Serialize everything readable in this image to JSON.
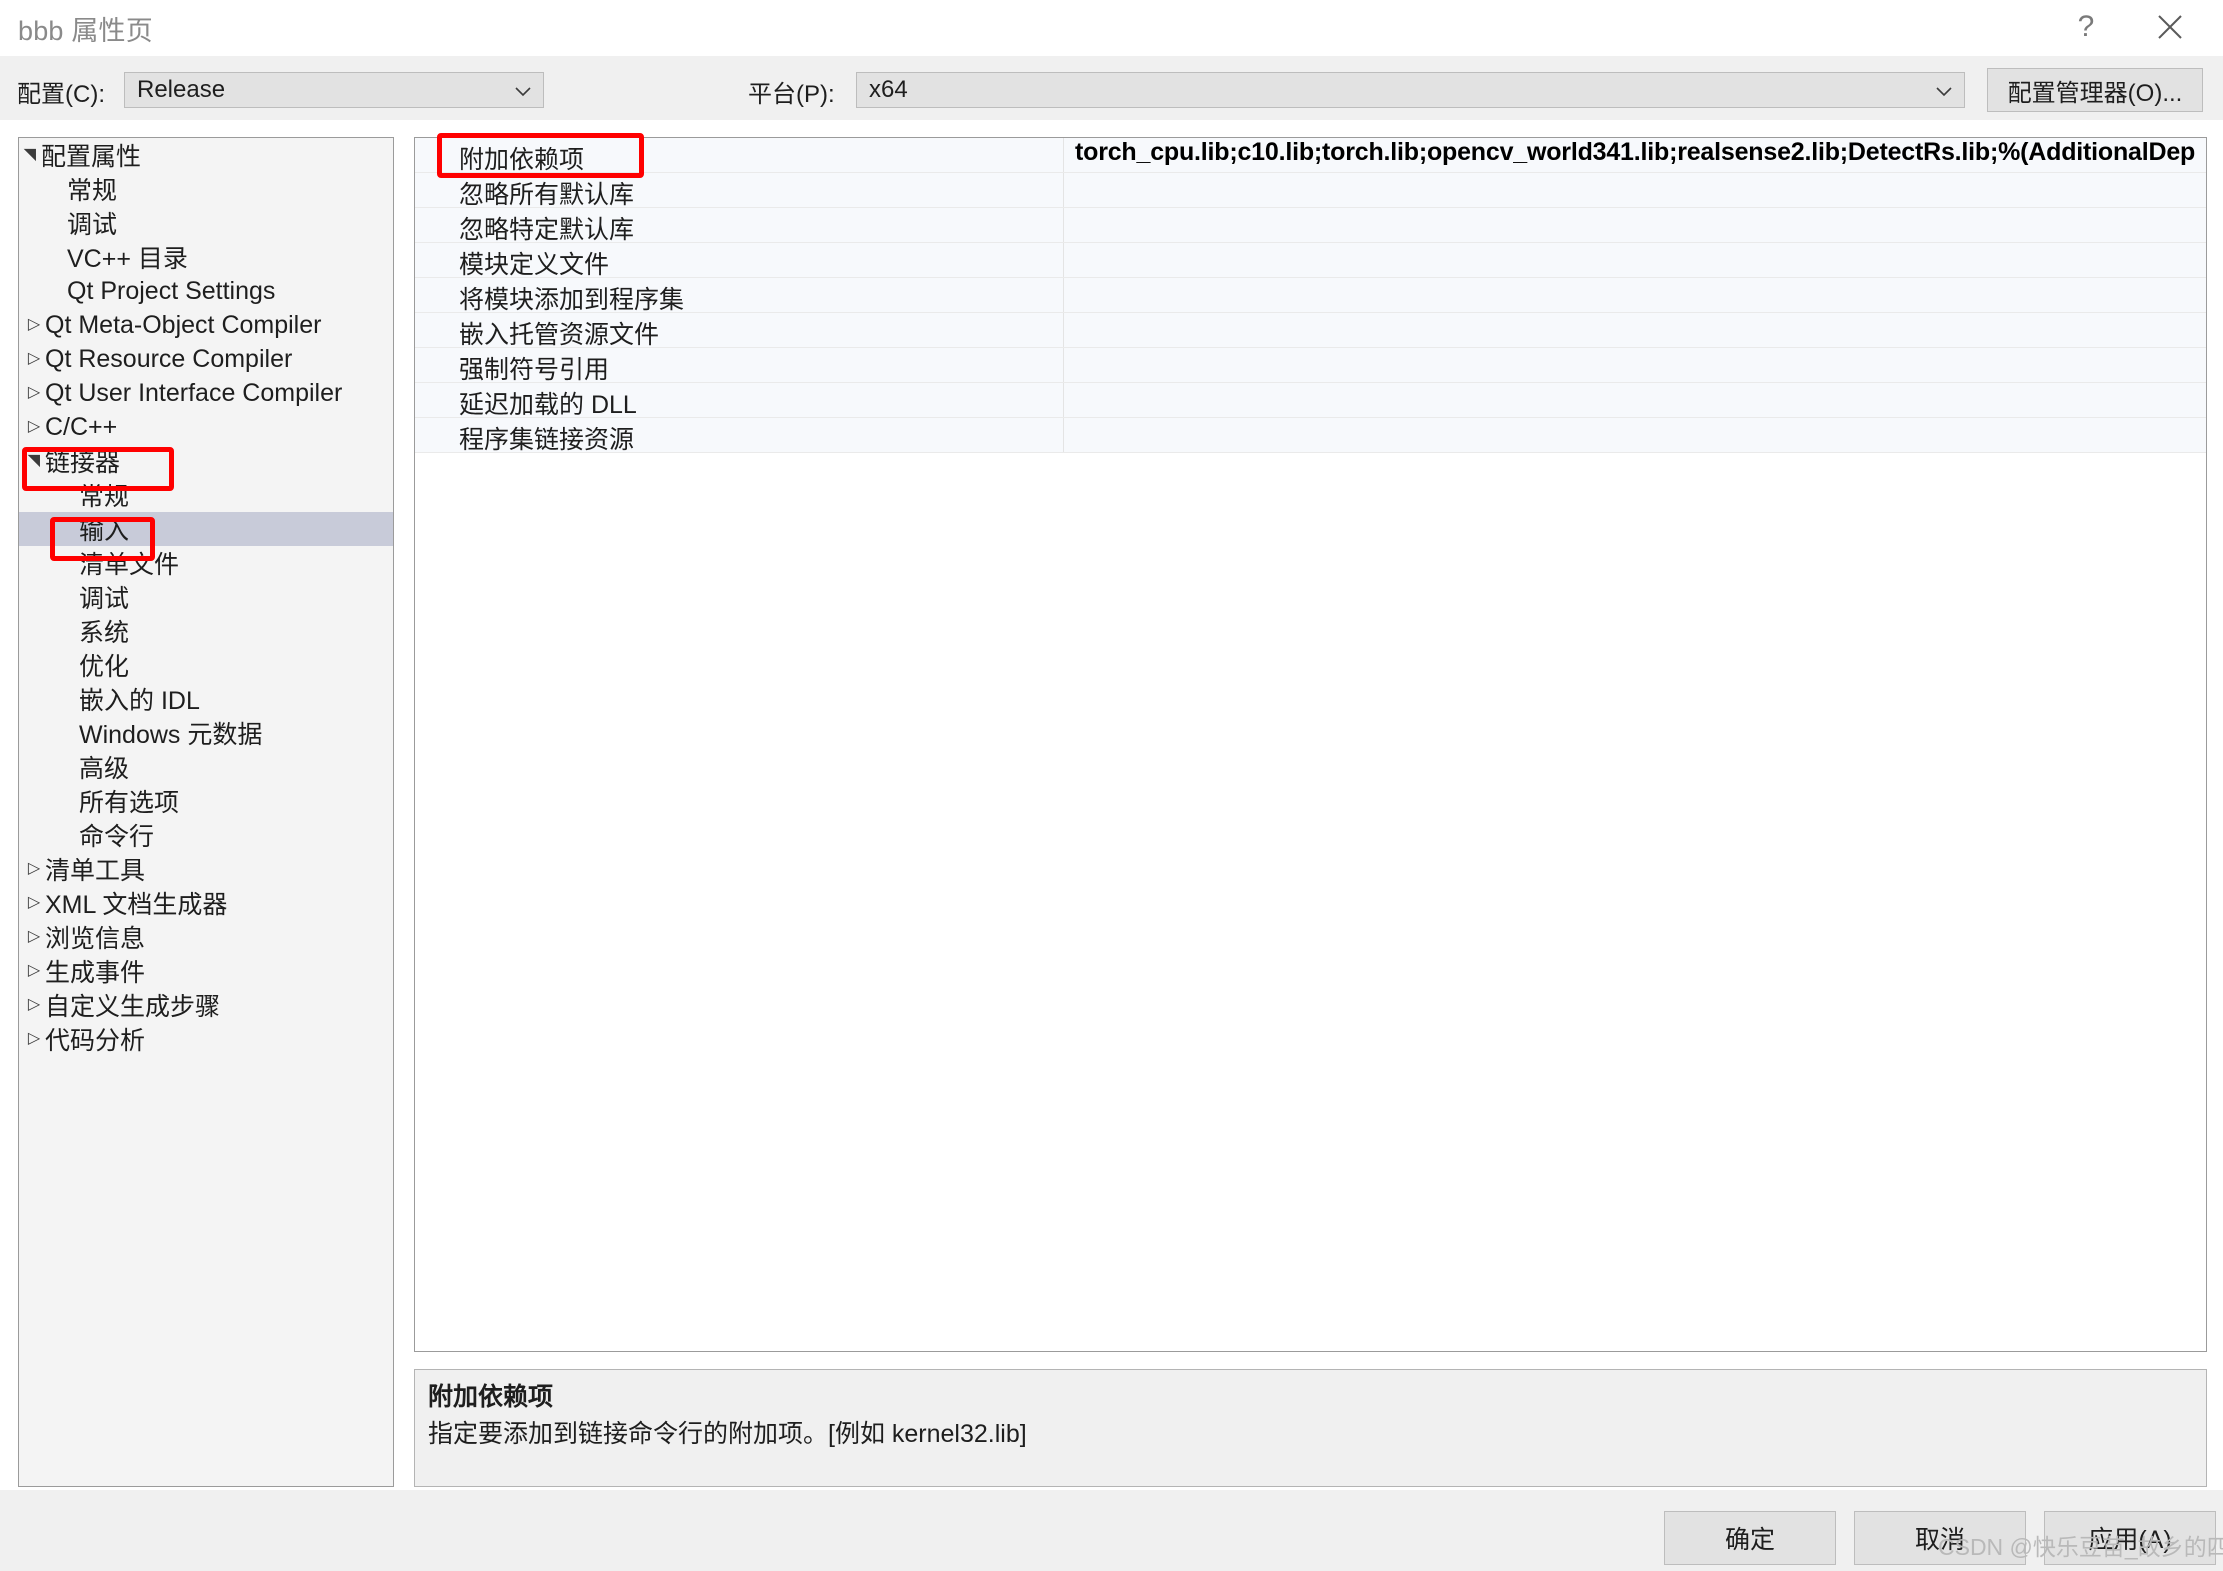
{
  "window": {
    "title": "bbb 属性页",
    "help_icon": "question-mark-icon",
    "help_glyph": "?",
    "close_icon": "close-icon"
  },
  "config_bar": {
    "configuration_label": "配置(C):",
    "configuration_value": "Release",
    "platform_label": "平台(P):",
    "platform_value": "x64",
    "config_manager_button": "配置管理器(O)...",
    "dropdown_icon": "chevron-down-icon"
  },
  "tree": {
    "items": [
      {
        "label": "配置属性",
        "indent": 14,
        "expander": "▲",
        "selected": false
      },
      {
        "label": "常规",
        "indent": 48,
        "expander": "",
        "selected": false
      },
      {
        "label": "调试",
        "indent": 48,
        "expander": "",
        "selected": false
      },
      {
        "label": "VC++ 目录",
        "indent": 48,
        "expander": "",
        "selected": false
      },
      {
        "label": "Qt Project Settings",
        "indent": 48,
        "expander": "",
        "selected": false
      },
      {
        "label": "Qt Meta-Object Compiler",
        "indent": 26,
        "expander": "▷",
        "selected": false
      },
      {
        "label": "Qt Resource Compiler",
        "indent": 26,
        "expander": "▷",
        "selected": false
      },
      {
        "label": "Qt User Interface Compiler",
        "indent": 26,
        "expander": "▷",
        "selected": false
      },
      {
        "label": "C/C++",
        "indent": 26,
        "expander": "▷",
        "selected": false
      },
      {
        "label": "链接器",
        "indent": 26,
        "expander": "▲",
        "selected": false
      },
      {
        "label": "常规",
        "indent": 60,
        "expander": "",
        "selected": false
      },
      {
        "label": "输入",
        "indent": 60,
        "expander": "",
        "selected": true
      },
      {
        "label": "清单文件",
        "indent": 60,
        "expander": "",
        "selected": false
      },
      {
        "label": "调试",
        "indent": 60,
        "expander": "",
        "selected": false
      },
      {
        "label": "系统",
        "indent": 60,
        "expander": "",
        "selected": false
      },
      {
        "label": "优化",
        "indent": 60,
        "expander": "",
        "selected": false
      },
      {
        "label": "嵌入的 IDL",
        "indent": 60,
        "expander": "",
        "selected": false
      },
      {
        "label": "Windows 元数据",
        "indent": 60,
        "expander": "",
        "selected": false
      },
      {
        "label": "高级",
        "indent": 60,
        "expander": "",
        "selected": false
      },
      {
        "label": "所有选项",
        "indent": 60,
        "expander": "",
        "selected": false
      },
      {
        "label": "命令行",
        "indent": 60,
        "expander": "",
        "selected": false
      },
      {
        "label": "清单工具",
        "indent": 26,
        "expander": "▷",
        "selected": false
      },
      {
        "label": "XML 文档生成器",
        "indent": 26,
        "expander": "▷",
        "selected": false
      },
      {
        "label": "浏览信息",
        "indent": 26,
        "expander": "▷",
        "selected": false
      },
      {
        "label": "生成事件",
        "indent": 26,
        "expander": "▷",
        "selected": false
      },
      {
        "label": "自定义生成步骤",
        "indent": 26,
        "expander": "▷",
        "selected": false
      },
      {
        "label": "代码分析",
        "indent": 26,
        "expander": "▷",
        "selected": false
      }
    ]
  },
  "properties": {
    "rows": [
      {
        "name": "附加依赖项",
        "value": "torch_cpu.lib;c10.lib;torch.lib;opencv_world341.lib;realsense2.lib;DetectRs.lib;%(AdditionalDep",
        "selected": true
      },
      {
        "name": "忽略所有默认库",
        "value": "",
        "selected": false
      },
      {
        "name": "忽略特定默认库",
        "value": "",
        "selected": false
      },
      {
        "name": "模块定义文件",
        "value": "",
        "selected": false
      },
      {
        "name": "将模块添加到程序集",
        "value": "",
        "selected": false
      },
      {
        "name": "嵌入托管资源文件",
        "value": "",
        "selected": false
      },
      {
        "name": "强制符号引用",
        "value": "",
        "selected": false
      },
      {
        "name": "延迟加载的 DLL",
        "value": "",
        "selected": false
      },
      {
        "name": "程序集链接资源",
        "value": "",
        "selected": false
      }
    ]
  },
  "description": {
    "title": "附加依赖项",
    "body": "指定要添加到链接命令行的附加项。[例如 kernel32.lib]"
  },
  "footer": {
    "ok": "确定",
    "cancel": "取消",
    "apply": "应用(A)"
  },
  "watermark": "CSDN @快乐豆苗_故乡的四季",
  "colors": {
    "annotation_red": "#ff0000",
    "selection_blue_gray": "#c8cbd9",
    "dialog_gray": "#f0f0f0"
  }
}
